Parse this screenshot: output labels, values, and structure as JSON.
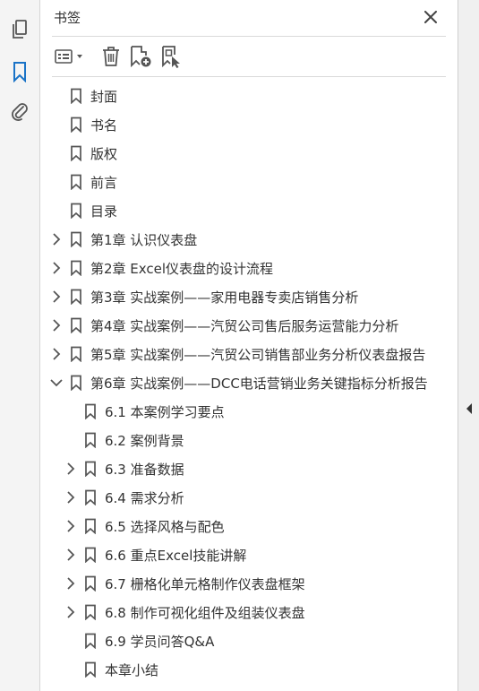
{
  "panel": {
    "title": "书签"
  },
  "left_rail": {
    "items": [
      {
        "name": "pages-icon",
        "active": false
      },
      {
        "name": "bookmark-icon",
        "active": true
      },
      {
        "name": "attachment-icon",
        "active": false
      }
    ]
  },
  "toolbar": {
    "items": [
      "options-menu-icon",
      "delete-icon",
      "new-bookmark-icon",
      "new-bookmark-from-structure-icon"
    ]
  },
  "bookmarks": [
    {
      "label": "封面",
      "level": 0,
      "expander": "none"
    },
    {
      "label": "书名",
      "level": 0,
      "expander": "none"
    },
    {
      "label": "版权",
      "level": 0,
      "expander": "none"
    },
    {
      "label": "前言",
      "level": 0,
      "expander": "none"
    },
    {
      "label": "目录",
      "level": 0,
      "expander": "none"
    },
    {
      "label": "第1章 认识仪表盘",
      "level": 0,
      "expander": "collapsed"
    },
    {
      "label": "第2章 Excel仪表盘的设计流程",
      "level": 0,
      "expander": "collapsed"
    },
    {
      "label": "第3章 实战案例——家用电器专卖店销售分析",
      "level": 0,
      "expander": "collapsed"
    },
    {
      "label": "第4章 实战案例——汽贸公司售后服务运营能力分析",
      "level": 0,
      "expander": "collapsed"
    },
    {
      "label": "第5章 实战案例——汽贸公司销售部业务分析仪表盘报告",
      "level": 0,
      "expander": "collapsed"
    },
    {
      "label": "第6章 实战案例——DCC电话营销业务关键指标分析报告",
      "level": 0,
      "expander": "expanded"
    },
    {
      "label": "6.1 本案例学习要点",
      "level": 1,
      "expander": "none"
    },
    {
      "label": "6.2 案例背景",
      "level": 1,
      "expander": "none"
    },
    {
      "label": "6.3 准备数据",
      "level": 1,
      "expander": "collapsed"
    },
    {
      "label": "6.4 需求分析",
      "level": 1,
      "expander": "collapsed"
    },
    {
      "label": "6.5 选择风格与配色",
      "level": 1,
      "expander": "collapsed"
    },
    {
      "label": "6.6 重点Excel技能讲解",
      "level": 1,
      "expander": "collapsed"
    },
    {
      "label": "6.7 栅格化单元格制作仪表盘框架",
      "level": 1,
      "expander": "collapsed"
    },
    {
      "label": "6.8 制作可视化组件及组装仪表盘",
      "level": 1,
      "expander": "collapsed"
    },
    {
      "label": "6.9 学员问答Q&A",
      "level": 1,
      "expander": "none"
    },
    {
      "label": "本章小结",
      "level": 1,
      "expander": "none"
    }
  ],
  "colors": {
    "accent": "#1a73c7",
    "icon": "#555555",
    "text": "#333333"
  }
}
